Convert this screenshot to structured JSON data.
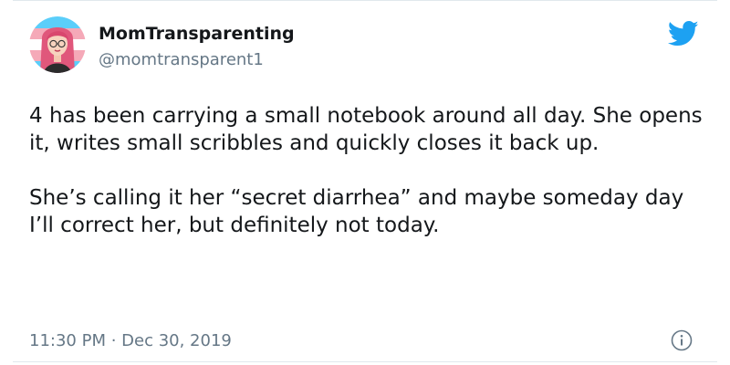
{
  "author": {
    "display_name": "MomTransparenting",
    "handle": "@momtransparent1",
    "avatar_icon": "avatar-illustration"
  },
  "tweet": {
    "paragraph_1": "4 has been carrying a small notebook around all day. She opens it, writes small scribbles and quickly closes it back up.",
    "paragraph_2": "She’s calling it her “secret diarrhea” and maybe someday day I’ll correct her, but definitely not today."
  },
  "meta": {
    "timestamp": "11:30 PM · Dec 30, 2019"
  },
  "icons": {
    "brand": "twitter-bird-icon",
    "info": "info-icon"
  },
  "colors": {
    "twitter_blue": "#1da1f2",
    "text_primary": "#14171a",
    "text_secondary": "#657786",
    "border": "#e1e8ed"
  }
}
